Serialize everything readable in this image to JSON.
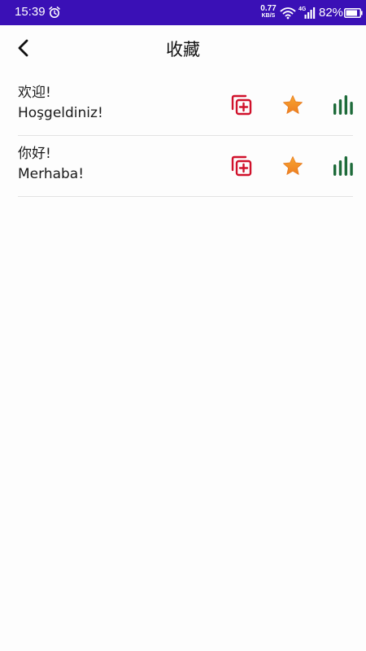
{
  "status_bar": {
    "time": "15:39",
    "net_speed_value": "0.77",
    "net_speed_unit": "KB/S",
    "network_type": "4G",
    "battery_percent": "82%",
    "background_color": "#3a10b6",
    "icons": [
      "alarm-icon",
      "wifi-icon",
      "signal-icon",
      "battery-icon"
    ]
  },
  "header": {
    "back_icon": "chevron-left-icon",
    "title": "收藏"
  },
  "favorites": [
    {
      "source": "欢迎!",
      "translation": "Hoşgeldiniz!"
    },
    {
      "source": "你好!",
      "translation": "Merhaba!"
    }
  ],
  "row_icons": {
    "copy_add": "copy-add-icon",
    "star": "star-icon",
    "stats": "bar-chart-icon"
  },
  "colors": {
    "copy_add": "#d0112b",
    "star": "#f3912a",
    "stats": "#1e6b3a",
    "divider": "#e3e3e3"
  }
}
